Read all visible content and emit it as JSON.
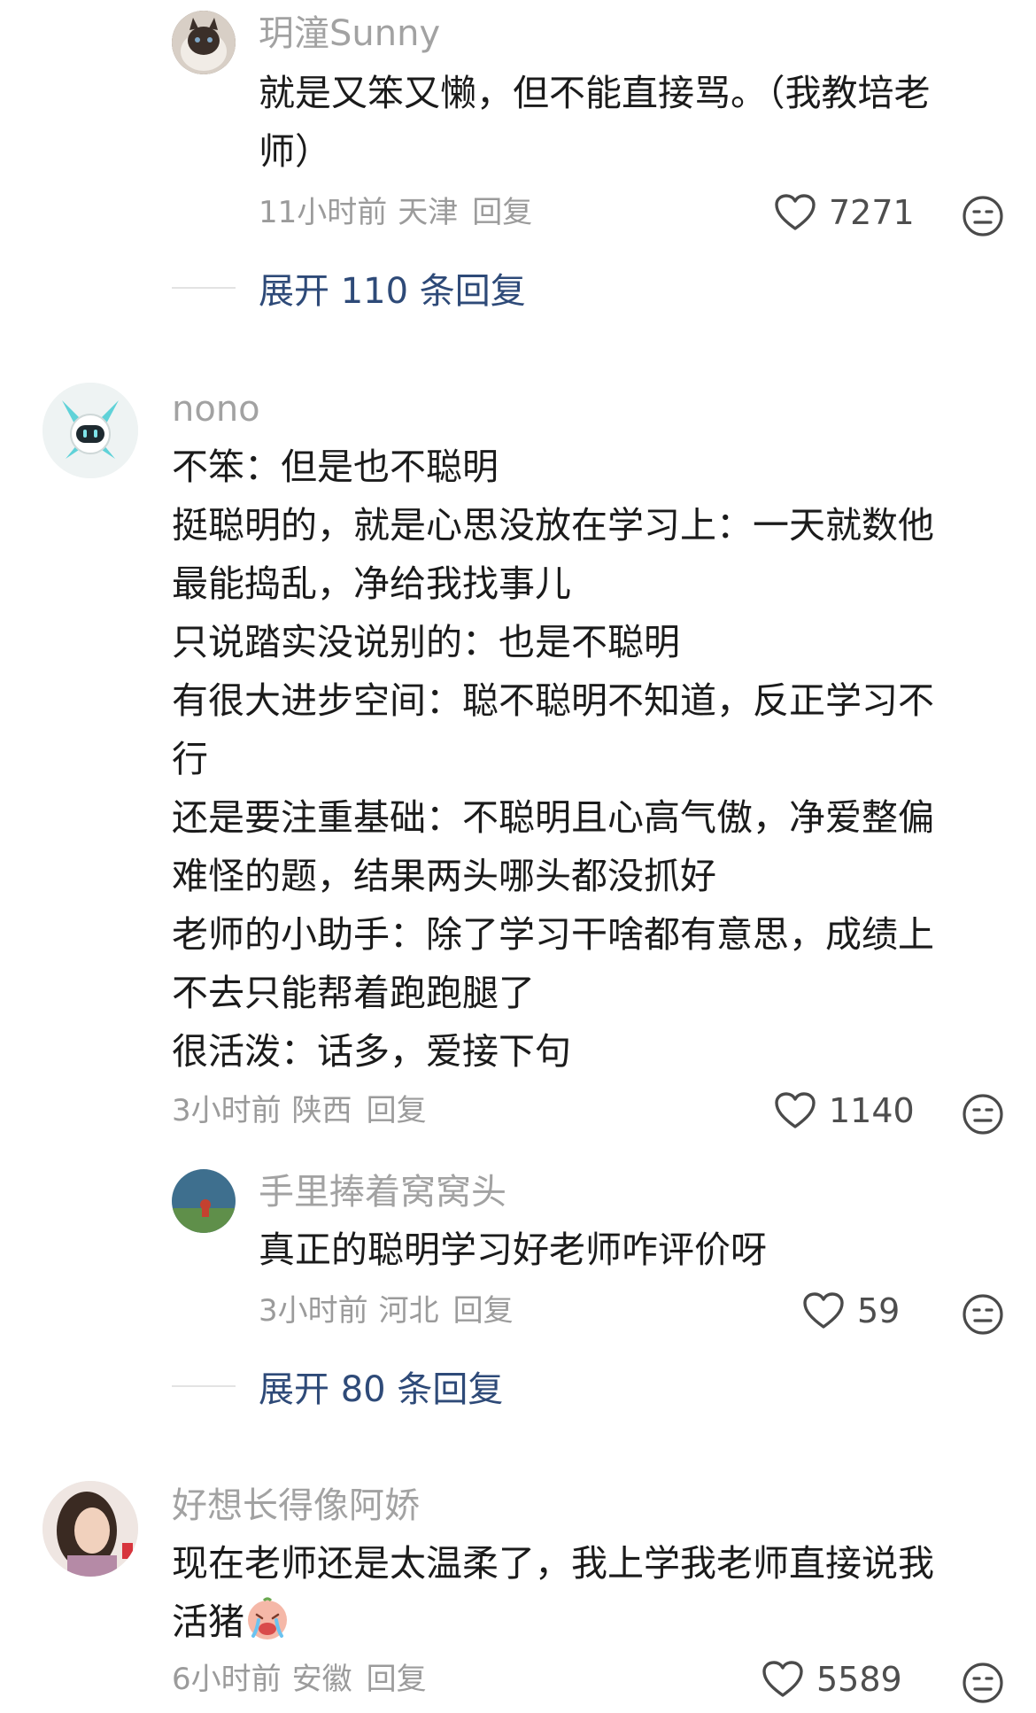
{
  "comments": [
    {
      "username": "玥潼Sunny",
      "lines": [
        "就是又笨又懒，但不能直接骂。（我教培老",
        "师）"
      ],
      "time": "11小时前",
      "location": "天津",
      "reply_label": "回复",
      "likes": "7271",
      "expand_label": "展开 110 条回复"
    },
    {
      "username": "nono",
      "lines": [
        "不笨：但是也不聪明",
        "挺聪明的，就是心思没放在学习上：一天就数他",
        "最能捣乱，净给我找事儿",
        "只说踏实没说别的：也是不聪明",
        "有很大进步空间：聪不聪明不知道，反正学习不",
        "行",
        "还是要注重基础：不聪明且心高气傲，净爱整偏",
        "难怪的题，结果两头哪头都没抓好",
        "老师的小助手：除了学习干啥都有意思，成绩上",
        "不去只能帮着跑跑腿了",
        "很活泼：话多，爱接下句"
      ],
      "time": "3小时前",
      "location": "陕西",
      "reply_label": "回复",
      "likes": "1140",
      "sub_reply": {
        "username": "手里捧着窝窝头",
        "text": "真正的聪明学习好老师咋评价呀",
        "time": "3小时前",
        "location": "河北",
        "reply_label": "回复",
        "likes": "59"
      },
      "expand_label": "展开 80 条回复"
    },
    {
      "username": "好想长得像阿娇",
      "lines": [
        "现在老师还是太温柔了，我上学我老师直接说我",
        "活猪"
      ],
      "time": "6小时前",
      "location": "安徽",
      "reply_label": "回复",
      "likes": "5589"
    }
  ],
  "icons": {
    "like": "heart-outline-icon",
    "dislike": "neutral-face-icon",
    "inline_emoji": "crying-face-emoji"
  },
  "colors": {
    "username": "#a2a2a2",
    "meta": "#9b9b9b",
    "expand": "#2e4a78",
    "text": "#1b1b1b"
  }
}
